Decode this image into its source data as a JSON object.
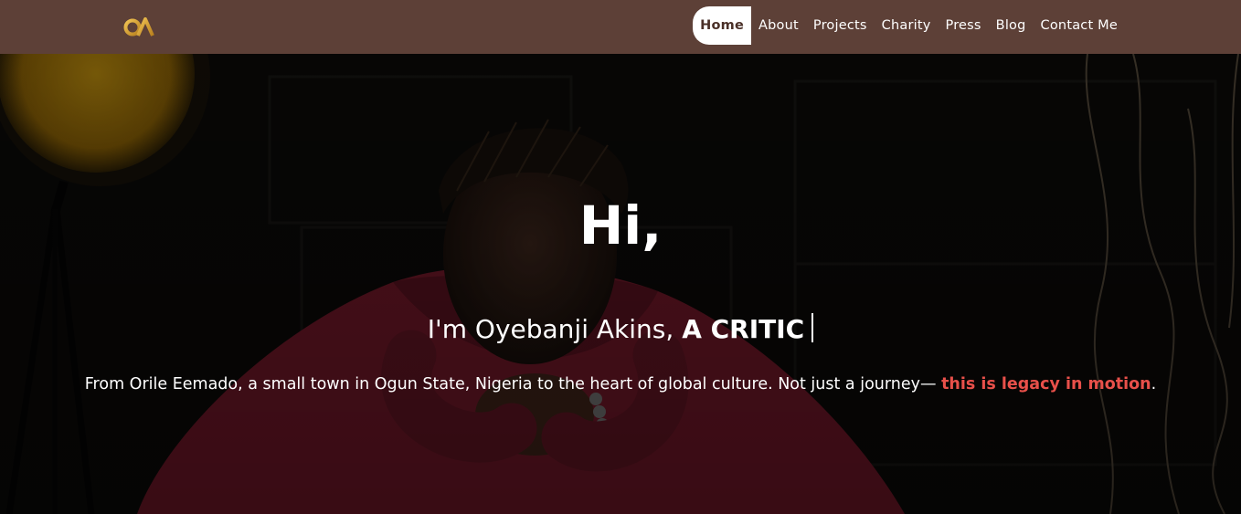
{
  "logo": {
    "text": "OA",
    "color": "#d9a437"
  },
  "nav": {
    "items": [
      {
        "label": "Home",
        "active": true
      },
      {
        "label": "About"
      },
      {
        "label": "Projects"
      },
      {
        "label": "Charity"
      },
      {
        "label": "Press"
      },
      {
        "label": "Blog"
      },
      {
        "label": "Contact Me"
      }
    ]
  },
  "hero": {
    "greeting": "Hi,",
    "intro_prefix": "I'm Oyebanji Akins,",
    "role": "A CRITIC",
    "tagline_prefix": "From Orile Eemado, a small town in Ogun State, Nigeria to the heart of global culture. Not just a journey—",
    "tagline_highlight": "this is legacy in motion",
    "tagline_suffix": "."
  },
  "colors": {
    "header_bg": "#5d4037",
    "active_nav_bg": "#ffffff",
    "highlight": "#e8504a",
    "lamp": "#d4a017"
  }
}
